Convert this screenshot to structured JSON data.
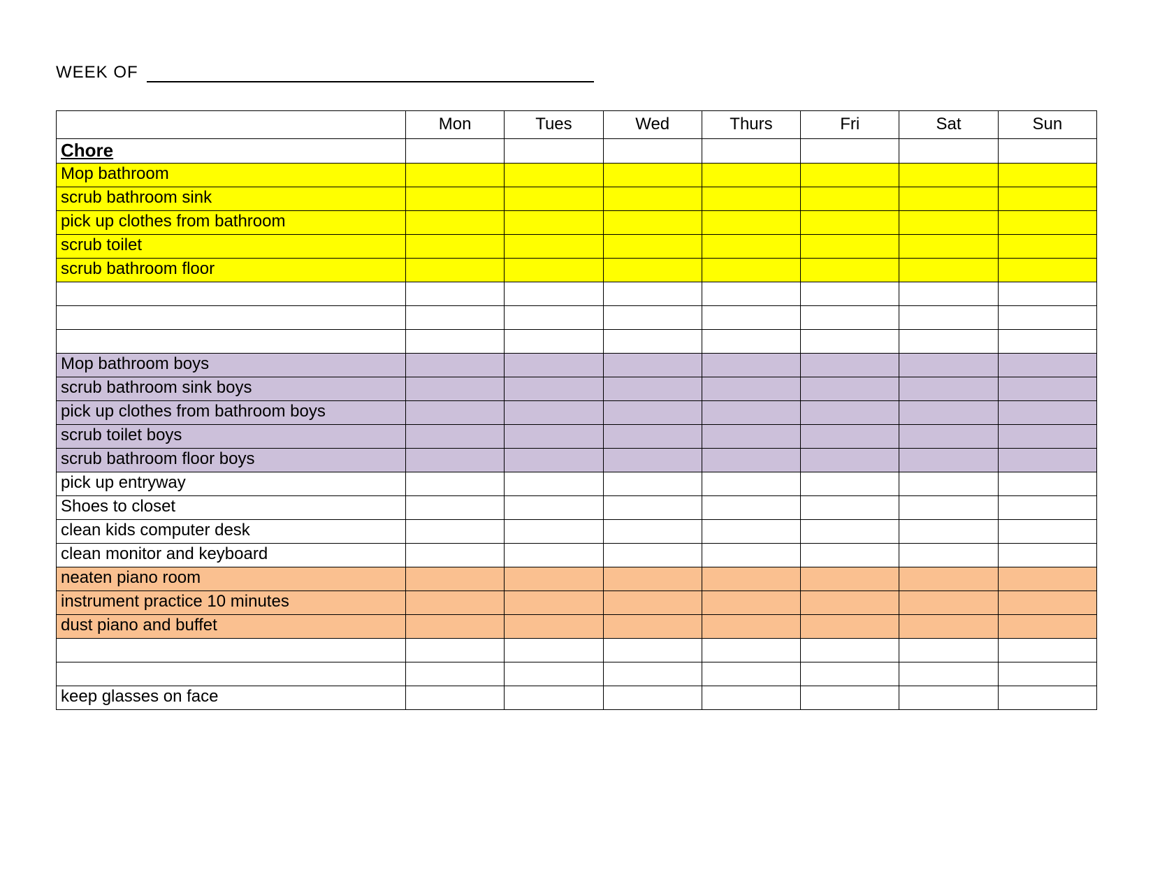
{
  "header": {
    "week_of_label": "WEEK OF"
  },
  "days": [
    "Mon",
    "Tues",
    "Wed",
    "Thurs",
    "Fri",
    "Sat",
    "Sun"
  ],
  "section_label": "Chore",
  "rows": [
    {
      "label": "Mop bathroom",
      "color": "yellow"
    },
    {
      "label": "scrub bathroom sink",
      "color": "yellow"
    },
    {
      "label": "pick up clothes from bathroom",
      "color": "yellow"
    },
    {
      "label": "scrub toilet",
      "color": "yellow"
    },
    {
      "label": "scrub bathroom floor",
      "color": "yellow"
    },
    {
      "label": "",
      "color": "white"
    },
    {
      "label": "",
      "color": "white"
    },
    {
      "label": "",
      "color": "white"
    },
    {
      "label": "Mop bathroom boys",
      "color": "purple"
    },
    {
      "label": "scrub bathroom sink  boys",
      "color": "purple"
    },
    {
      "label": "pick up clothes from bathroom boys",
      "color": "purple"
    },
    {
      "label": "scrub toilet boys",
      "color": "purple"
    },
    {
      "label": "scrub bathroom floor boys",
      "color": "purple"
    },
    {
      "label": "pick up entryway",
      "color": "white"
    },
    {
      "label": "Shoes to closet",
      "color": "white"
    },
    {
      "label": "clean kids computer desk",
      "color": "white"
    },
    {
      "label": "clean monitor and keyboard",
      "color": "white"
    },
    {
      "label": "neaten piano room",
      "color": "orange"
    },
    {
      "label": "instrument practice 10 minutes",
      "color": "orange"
    },
    {
      "label": "dust piano and buffet",
      "color": "orange"
    },
    {
      "label": "",
      "color": "white"
    },
    {
      "label": "",
      "color": "white"
    },
    {
      "label": "keep glasses on face",
      "color": "white"
    }
  ],
  "colors": {
    "yellow": "#ffff00",
    "purple": "#ccc0da",
    "orange": "#fac090",
    "white": "#ffffff"
  }
}
